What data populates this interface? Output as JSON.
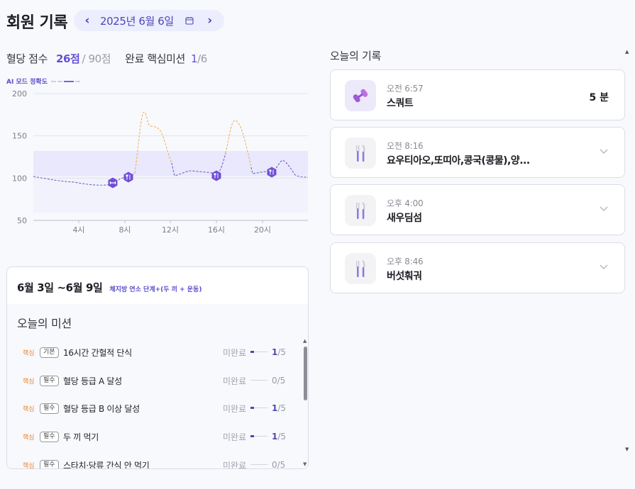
{
  "header": {
    "title": "회원 기록",
    "date": "2025년 6월 6일",
    "prev_label": "‹",
    "next_label": "›"
  },
  "score": {
    "label": "혈당 점수",
    "value": "26점",
    "max": "/ 90점",
    "missions_label": "완료 핵심미션",
    "missions_done": "1",
    "missions_total": "/6"
  },
  "ai_mode": {
    "label": "AI 모드 정확도"
  },
  "chart_data": {
    "type": "line",
    "y_ticks": [
      200,
      150,
      100,
      50
    ],
    "x_ticks": [
      "4시",
      "8시",
      "12시",
      "16시",
      "20시"
    ],
    "ylim": [
      50,
      200
    ],
    "target_band": [
      70,
      140
    ],
    "colors": {
      "normal": "#6c63c4",
      "high": "#f3b15a",
      "band": "#e9e8fc",
      "lower": "#f2f2fd"
    }
  },
  "week": {
    "range": "6월 3일 ~6월 9일",
    "stage": "체지방 연소 단계+(두 끼 + 운동)"
  },
  "missions": {
    "title": "오늘의 미션",
    "items": [
      {
        "tag": "핵심",
        "badge": "기본",
        "name": "16시간 간헐적 단식",
        "status": "미완료",
        "done": "1",
        "total": "/5"
      },
      {
        "tag": "핵심",
        "badge": "필수",
        "name": "혈당 등급 A 달성",
        "status": "미완료",
        "done": "0",
        "total": "/5"
      },
      {
        "tag": "핵심",
        "badge": "필수",
        "name": "혈당 등급 B 이상 달성",
        "status": "미완료",
        "done": "1",
        "total": "/5"
      },
      {
        "tag": "핵심",
        "badge": "필수",
        "name": "두 끼 먹기",
        "status": "미완료",
        "done": "1",
        "total": "/5"
      },
      {
        "tag": "핵심",
        "badge": "필수",
        "name": "스타치·당류 간식 안 먹기",
        "status": "미완료",
        "done": "0",
        "total": "/5"
      }
    ]
  },
  "records": {
    "title": "오늘의 기록",
    "items": [
      {
        "time": "오전 6:57",
        "name": "스쿼트",
        "extra": "5 분",
        "icon": "dumbbell-icon"
      },
      {
        "time": "오전 8:16",
        "name": "요우티아오,또띠아,콩국(콩물),양...",
        "icon": "utensils-icon"
      },
      {
        "time": "오후 4:00",
        "name": "새우딤섬",
        "icon": "utensils-icon"
      },
      {
        "time": "오후 8:46",
        "name": "버섯훠궈",
        "icon": "utensils-icon"
      }
    ]
  }
}
